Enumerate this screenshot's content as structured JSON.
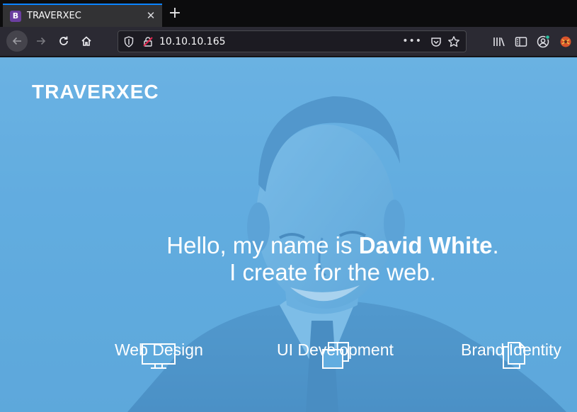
{
  "browser": {
    "tab": {
      "title": "TRAVERXEC",
      "favicon_letter": "B"
    },
    "url": "10.10.10.165",
    "url_more": "•••"
  },
  "page": {
    "brand": "TRAVERXEC",
    "intro": {
      "greeting": "Hello, my name is ",
      "name": "David White",
      "period": ".",
      "tagline": "I create for the web."
    },
    "services": [
      {
        "label": "Web Design",
        "icon": "monitor-icon"
      },
      {
        "label": "UI Development",
        "icon": "stacked-windows-icon"
      },
      {
        "label": "Brand Identity",
        "icon": "documents-icon"
      }
    ]
  },
  "colors": {
    "hero_overlay": "#62ade0",
    "tab_accent": "#0a84ff"
  }
}
